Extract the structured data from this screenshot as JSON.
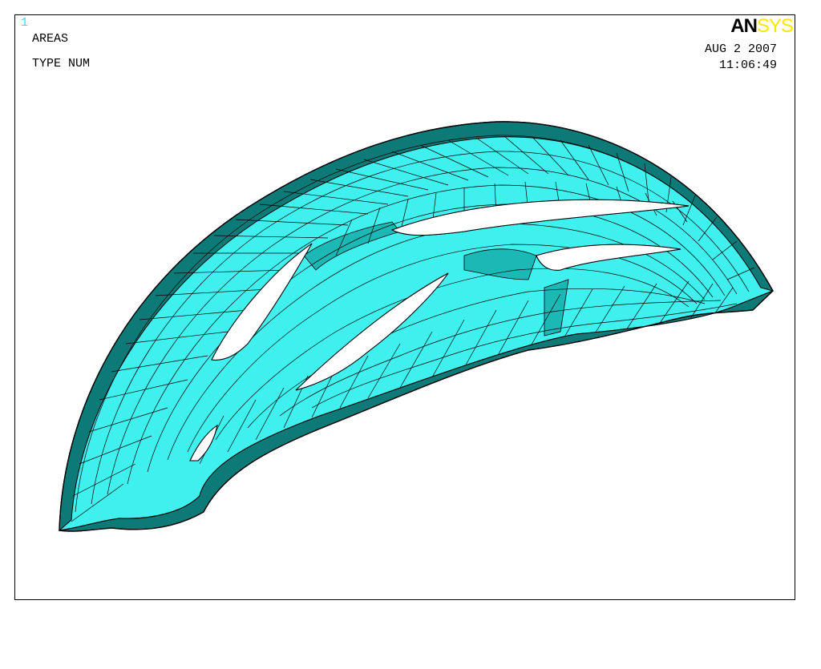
{
  "window_number": "1",
  "labels": {
    "line1": "AREAS",
    "line2": "TYPE NUM"
  },
  "logo": {
    "part1": "AN",
    "part2": "SYS"
  },
  "date": "AUG  2 2007",
  "time": "11:06:49",
  "colors": {
    "surface": "#3ff0ee",
    "shadow": "#0d7a78",
    "mesh": "#000000",
    "logo_accent": "#ffe600",
    "window_number": "#38d8e6"
  }
}
